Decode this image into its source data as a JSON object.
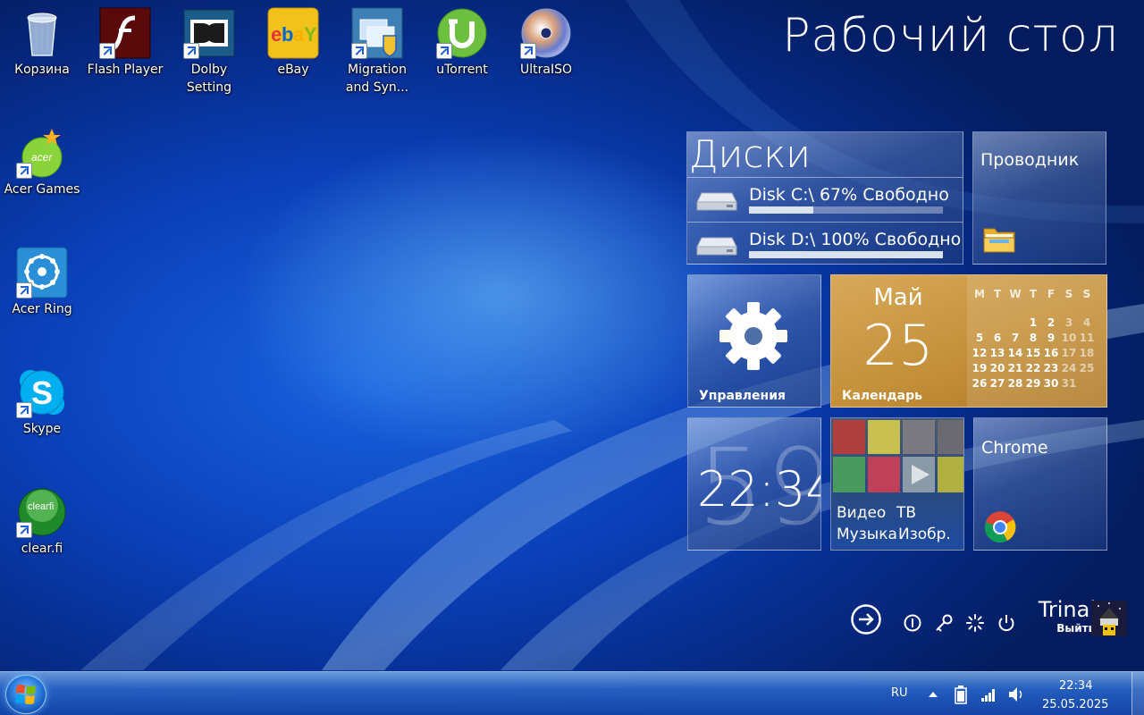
{
  "desktop": {
    "title": "Рабочий стол",
    "icons": [
      {
        "label": "Корзина"
      },
      {
        "label": "Flash Player"
      },
      {
        "label": "Dolby Setting"
      },
      {
        "label": "eBay"
      },
      {
        "label": "Migration and Syn..."
      },
      {
        "label": "uTorrent"
      },
      {
        "label": "UltraISO"
      },
      {
        "label": "Acer Games"
      },
      {
        "label": "Acer Ring"
      },
      {
        "label": "Skype"
      },
      {
        "label": "clear.fi"
      }
    ]
  },
  "tiles": {
    "disks": {
      "title": "Диски",
      "items": [
        {
          "text": "Disk C:\\ 67% Свободно",
          "free_percent": 67,
          "fill_fraction": 0.33
        },
        {
          "text": "Disk D:\\ 100% Свободно",
          "free_percent": 100,
          "fill_fraction": 1.0
        }
      ]
    },
    "explorer": {
      "label": "Проводник"
    },
    "control": {
      "label": "Управления"
    },
    "calendar": {
      "month": "Май",
      "day": "25",
      "label": "Календарь",
      "weekdays": [
        "M",
        "T",
        "W",
        "T",
        "F",
        "S",
        "S"
      ],
      "weeks": [
        [
          "",
          "",
          "",
          "1",
          "2",
          "3",
          "4"
        ],
        [
          "5",
          "6",
          "7",
          "8",
          "9",
          "10",
          "11"
        ],
        [
          "12",
          "13",
          "14",
          "15",
          "16",
          "17",
          "18"
        ],
        [
          "19",
          "20",
          "21",
          "22",
          "23",
          "24",
          "25"
        ],
        [
          "26",
          "27",
          "28",
          "29",
          "30",
          "31",
          ""
        ]
      ]
    },
    "clock": {
      "time": "22:34",
      "background_seconds": "59"
    },
    "media": {
      "labels": [
        "Видео",
        "ТВ",
        "Музыка",
        "Изобр."
      ]
    },
    "chrome": {
      "label": "Chrome"
    }
  },
  "user": {
    "name": "Trinal",
    "logout": "Выйти"
  },
  "taskbar": {
    "language": "RU",
    "time": "22:34",
    "date": "25.05.2025"
  }
}
